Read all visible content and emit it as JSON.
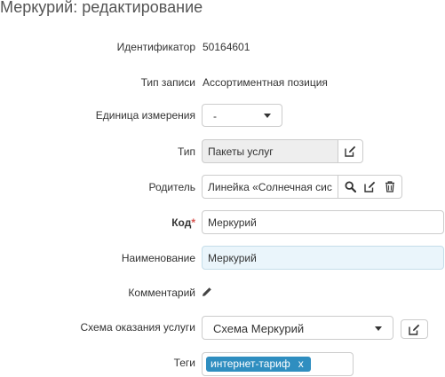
{
  "page": {
    "title": "Меркурий: редактирование"
  },
  "fields": {
    "identifier": {
      "label": "Идентификатор",
      "value": "50164601"
    },
    "record_type": {
      "label": "Тип записи",
      "value": "Ассортиментная позиция"
    },
    "unit": {
      "label": "Единица измерения",
      "value": "-"
    },
    "type": {
      "label": "Тип",
      "value": "Пакеты услуг"
    },
    "parent": {
      "label": "Родитель",
      "value": "Линейка «Солнечная сис"
    },
    "code": {
      "label": "Код",
      "required_mark": "*",
      "value": "Меркурий"
    },
    "name": {
      "label": "Наименование",
      "value": "Меркурий"
    },
    "comment": {
      "label": "Комментарий"
    },
    "service_scheme": {
      "label": "Схема оказания услуги",
      "value": "Схема Меркурий"
    },
    "tags": {
      "label": "Теги",
      "items": [
        {
          "label": "интернет-тариф",
          "remove": "x"
        }
      ]
    }
  },
  "colors": {
    "accent": "#2f8ec0",
    "required": "#d9534f",
    "focused_bg": "#eaf5fb",
    "readonly_bg": "#eeeeee"
  },
  "icons": [
    "edit-icon",
    "search-icon",
    "trash-icon",
    "pencil-icon",
    "caret-down-icon"
  ]
}
